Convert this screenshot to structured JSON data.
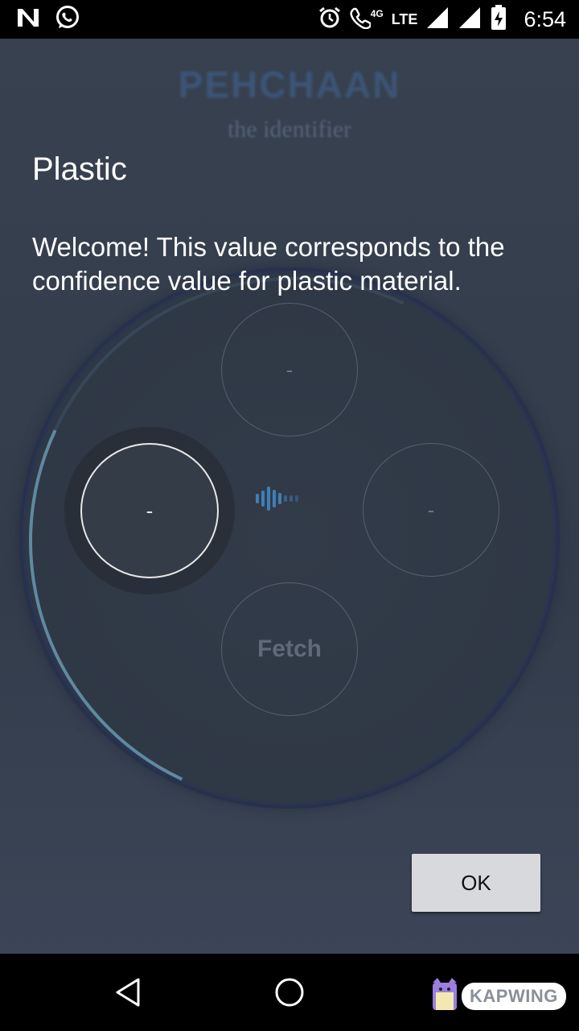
{
  "status_bar": {
    "time": "6:54",
    "network_4g": "4G",
    "network_lte": "LTE",
    "icons": [
      "n-notification-icon",
      "whatsapp-icon",
      "alarm-icon",
      "volte-call-icon",
      "signal-icon",
      "signal-icon",
      "battery-charging-icon"
    ]
  },
  "background_app": {
    "brand": "PEHCHAAN",
    "tagline": "the identifier",
    "nodes": {
      "top": "-",
      "left": "-",
      "right": "-",
      "bottom": "Fetch"
    },
    "voice_icon": "voice-wave-icon"
  },
  "dialog": {
    "title": "Plastic",
    "message": "Welcome! This value corresponds to the confidence value for plastic material.",
    "ok_label": "OK"
  },
  "nav_bar": {
    "icons": [
      "back-icon",
      "home-icon"
    ]
  },
  "watermark": {
    "text": "KAPWING"
  },
  "colors": {
    "accent": "#3e7fb7",
    "background": "#37414f",
    "button": "#d8d9dc"
  }
}
